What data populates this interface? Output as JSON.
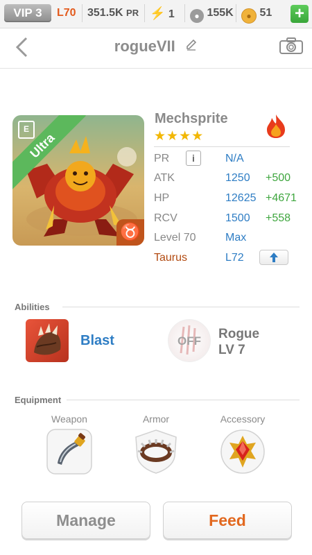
{
  "topbar": {
    "vip": "VIP 3",
    "level": "L70",
    "power": "351.5K",
    "power_unit": "PR",
    "energy": "1",
    "paw": "155K",
    "coins": "51",
    "plus": "+"
  },
  "header": {
    "title": "rogueVII",
    "back_icon": "chevron-left-icon",
    "edit_icon": "pencil-icon",
    "camera_icon": "camera-icon"
  },
  "monster": {
    "name": "Mechsprite",
    "rarity": "Ultra",
    "stars": "★★★★",
    "star_count": 4,
    "element_icon": "fire-icon",
    "stats": [
      {
        "label": "PR",
        "value": "N/A",
        "bonus": ""
      },
      {
        "label": "ATK",
        "value": "1250",
        "bonus": "+500"
      },
      {
        "label": "HP",
        "value": "12625",
        "bonus": "+4671"
      },
      {
        "label": "RCV",
        "value": "1500",
        "bonus": "+558"
      },
      {
        "label": "Level 70",
        "value": "Max",
        "bonus": ""
      },
      {
        "label": "Taurus",
        "value": "L72",
        "bonus": ""
      }
    ],
    "zodiac_symbol": "♉",
    "colors": {
      "label": "#888888",
      "value": "#2e7dc4",
      "bonus": "#3fa63f",
      "zodiac": "#b24a10"
    }
  },
  "abilities": {
    "title": "Abilities",
    "active": {
      "name": "Blast",
      "icon": "claw-icon"
    },
    "passive": {
      "status": "OFF",
      "name": "Rogue",
      "level": "LV 7"
    }
  },
  "equipment": {
    "title": "Equipment",
    "slots": [
      {
        "label": "Weapon",
        "icon": "blade-icon"
      },
      {
        "label": "Armor",
        "icon": "spiked-collar-icon"
      },
      {
        "label": "Accessory",
        "icon": "ruby-amulet-icon"
      }
    ]
  },
  "actions": {
    "manage": "Manage",
    "feed": "Feed"
  }
}
